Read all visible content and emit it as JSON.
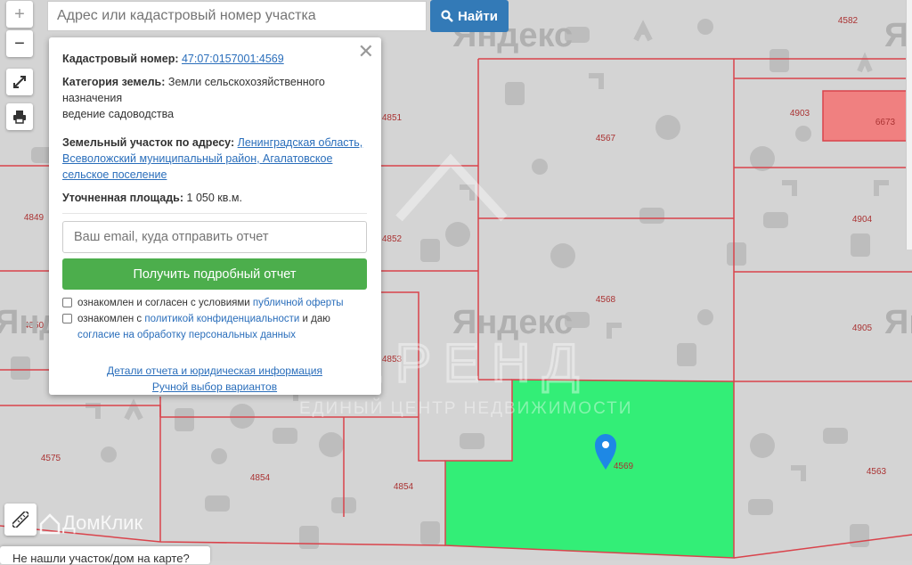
{
  "map": {
    "yandex_watermark": "Яндекс",
    "brand_watermark": "ЕРЕНД",
    "brand_tagline": "ЕДИНЫЙ ЦЕНТР НЕДВИЖИМОСТИ",
    "domclick_logo": "ДомКлик",
    "parcel_numbers": [
      "4582",
      "4903",
      "6673",
      "4567",
      "4851",
      "4849",
      "4904",
      "4852",
      "4568",
      "4850",
      "4905",
      "4853",
      "4575",
      "4854",
      "4854",
      "4569",
      "4563"
    ],
    "selected_parcel_color": "#33ee77",
    "highlight_parcel_color": "#f08080",
    "boundary_color": "#d9434b",
    "marker_color": "#1e88e5"
  },
  "controls": {
    "zoom_in": "+",
    "zoom_out": "−",
    "fullscreen_icon": "expand-icon",
    "print_icon": "printer-icon",
    "ruler_icon": "ruler-icon"
  },
  "search": {
    "placeholder": "Адрес или кадастровый номер участка",
    "button_label": "Найти"
  },
  "popup": {
    "cadastral_label": "Кадастровый номер:",
    "cadastral_value": "47:07:0157001:4569",
    "category_label": "Категория земель:",
    "category_value": "Земли сельскохозяйственного назначения",
    "usage": "ведение садоводства",
    "address_label": "Земельный участок по адресу:",
    "address_value": "Ленинградская область, Всеволожский муниципальный район, Агалатовское сельское поселение",
    "area_label": "Уточненная площадь:",
    "area_value": "1 050 кв.м.",
    "email_placeholder": "Ваш email, куда отправить отчет",
    "report_button": "Получить подробный отчет",
    "consent1_text": "ознакомлен и согласен с условиями",
    "consent1_link": "публичной оферты",
    "consent2_text_a": "ознакомлен с",
    "consent2_link_a": "политикой конфиденциальности",
    "consent2_text_b": "и даю",
    "consent2_link_b": "согласие на обработку персональных данных",
    "details_link": "Детали отчета и юридическая информация",
    "manual_link": "Ручной выбор вариантов"
  },
  "bottom_bar": {
    "text": "Не нашли участок/дом на карте?"
  }
}
